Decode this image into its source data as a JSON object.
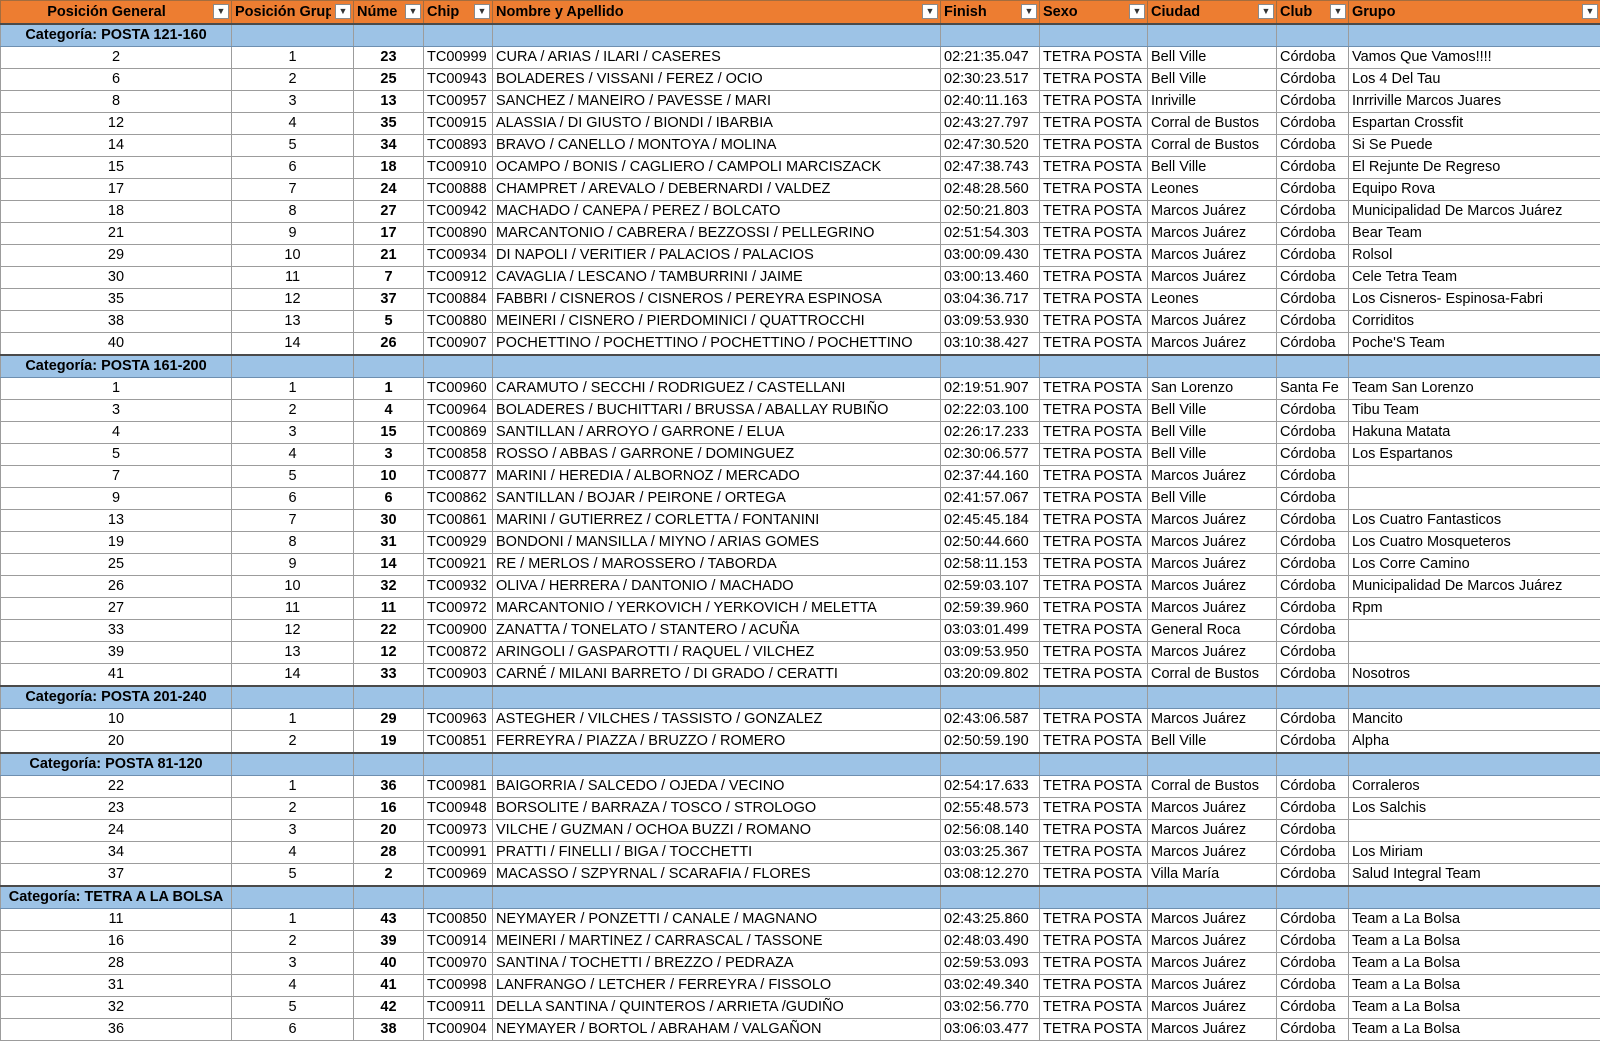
{
  "headers": {
    "pos_general": "Posición General",
    "pos_grupo": "Posición Grup",
    "numero": "Núme",
    "chip": "Chip",
    "nombre": "Nombre y Apellido",
    "finish": "Finish",
    "sexo": "Sexo",
    "ciudad": "Ciudad",
    "club": "Club",
    "grupo": "Grupo"
  },
  "icons": {
    "filter": "dropdown-filter-icon"
  },
  "colors": {
    "header": "#ED7D31",
    "category": "#9DC3E6"
  },
  "sections": [
    {
      "category": "Categoría: POSTA 121-160",
      "rows": [
        [
          "2",
          "1",
          "23",
          "TC00999",
          "CURA / ARIAS / ILARI / CASERES",
          "02:21:35.047",
          "TETRA POSTA",
          "Bell Ville",
          "Córdoba",
          "Vamos Que Vamos!!!!"
        ],
        [
          "6",
          "2",
          "25",
          "TC00943",
          "BOLADERES / VISSANI / FEREZ / OCIO",
          "02:30:23.517",
          "TETRA POSTA",
          "Bell Ville",
          "Córdoba",
          "Los 4 Del Tau"
        ],
        [
          "8",
          "3",
          "13",
          "TC00957",
          "SANCHEZ / MANEIRO / PAVESSE / MARI",
          "02:40:11.163",
          "TETRA POSTA",
          "Inriville",
          "Córdoba",
          "Inrriville Marcos Juares"
        ],
        [
          "12",
          "4",
          "35",
          "TC00915",
          "ALASSIA / DI GIUSTO / BIONDI / IBARBIA",
          "02:43:27.797",
          "TETRA POSTA",
          "Corral de Bustos",
          "Córdoba",
          "Espartan Crossfit"
        ],
        [
          "14",
          "5",
          "34",
          "TC00893",
          "BRAVO / CANELLO / MONTOYA / MOLINA",
          "02:47:30.520",
          "TETRA POSTA",
          "Corral de Bustos",
          "Córdoba",
          "Si Se Puede"
        ],
        [
          "15",
          "6",
          "18",
          "TC00910",
          "OCAMPO / BONIS / CAGLIERO / CAMPOLI MARCISZACK",
          "02:47:38.743",
          "TETRA POSTA",
          "Bell Ville",
          "Córdoba",
          "El Rejunte De Regreso"
        ],
        [
          "17",
          "7",
          "24",
          "TC00888",
          "CHAMPRET / AREVALO  / DEBERNARDI / VALDEZ",
          "02:48:28.560",
          "TETRA POSTA",
          "Leones",
          "Córdoba",
          "Equipo Rova"
        ],
        [
          "18",
          "8",
          "27",
          "TC00942",
          "MACHADO / CANEPA / PEREZ / BOLCATO",
          "02:50:21.803",
          "TETRA POSTA",
          "Marcos Juárez",
          "Córdoba",
          "Municipalidad De Marcos Juárez"
        ],
        [
          "21",
          "9",
          "17",
          "TC00890",
          "MARCANTONIO / CABRERA / BEZZOSSI / PELLEGRINO",
          "02:51:54.303",
          "TETRA POSTA",
          "Marcos Juárez",
          "Córdoba",
          "Bear Team"
        ],
        [
          "29",
          "10",
          "21",
          "TC00934",
          "DI NAPOLI / VERITIER / PALACIOS / PALACIOS",
          "03:00:09.430",
          "TETRA POSTA",
          "Marcos Juárez",
          "Córdoba",
          "Rolsol"
        ],
        [
          "30",
          "11",
          "7",
          "TC00912",
          "CAVAGLIA / LESCANO / TAMBURRINI / JAIME",
          "03:00:13.460",
          "TETRA POSTA",
          "Marcos Juárez",
          "Córdoba",
          "Cele Tetra Team"
        ],
        [
          "35",
          "12",
          "37",
          "TC00884",
          "FABBRI / CISNEROS / CISNEROS / PEREYRA ESPINOSA",
          "03:04:36.717",
          "TETRA POSTA",
          "Leones",
          "Córdoba",
          "Los Cisneros- Espinosa-Fabri"
        ],
        [
          "38",
          "13",
          "5",
          "TC00880",
          "MEINERI / CISNERO / PIERDOMINICI / QUATTROCCHI",
          "03:09:53.930",
          "TETRA POSTA",
          "Marcos Juárez",
          "Córdoba",
          "Corriditos"
        ],
        [
          "40",
          "14",
          "26",
          "TC00907",
          "POCHETTINO / POCHETTINO / POCHETTINO / POCHETTINO",
          "03:10:38.427",
          "TETRA POSTA",
          "Marcos Juárez",
          "Córdoba",
          "Poche'S Team"
        ]
      ]
    },
    {
      "category": "Categoría: POSTA 161-200",
      "rows": [
        [
          "1",
          "1",
          "1",
          "TC00960",
          "CARAMUTO / SECCHI / RODRIGUEZ / CASTELLANI",
          "02:19:51.907",
          "TETRA POSTA",
          "San Lorenzo",
          "Santa Fe",
          "Team San Lorenzo"
        ],
        [
          "3",
          "2",
          "4",
          "TC00964",
          "BOLADERES / BUCHITTARI / BRUSSA / ABALLAY RUBIÑO",
          "02:22:03.100",
          "TETRA POSTA",
          "Bell Ville",
          "Córdoba",
          "Tibu Team"
        ],
        [
          "4",
          "3",
          "15",
          "TC00869",
          "SANTILLAN  / ARROYO / GARRONE / ELUA",
          "02:26:17.233",
          "TETRA POSTA",
          "Bell Ville",
          "Córdoba",
          "Hakuna Matata"
        ],
        [
          "5",
          "4",
          "3",
          "TC00858",
          "ROSSO / ABBAS / GARRONE / DOMINGUEZ",
          "02:30:06.577",
          "TETRA POSTA",
          "Bell Ville",
          "Córdoba",
          "Los Espartanos"
        ],
        [
          "7",
          "5",
          "10",
          "TC00877",
          "MARINI / HEREDIA /  ALBORNOZ / MERCADO",
          "02:37:44.160",
          "TETRA POSTA",
          "Marcos Juárez",
          "Córdoba",
          ""
        ],
        [
          "9",
          "6",
          "6",
          "TC00862",
          "SANTILLAN / BOJAR / PEIRONE / ORTEGA",
          "02:41:57.067",
          "TETRA POSTA",
          "Bell Ville",
          "Córdoba",
          ""
        ],
        [
          "13",
          "7",
          "30",
          "TC00861",
          "MARINI / GUTIERREZ / CORLETTA / FONTANINI",
          "02:45:45.184",
          "TETRA POSTA",
          "Marcos Juárez",
          "Córdoba",
          "Los Cuatro Fantasticos"
        ],
        [
          "19",
          "8",
          "31",
          "TC00929",
          "BONDONI / MANSILLA / MIYNO / ARIAS GOMES",
          "02:50:44.660",
          "TETRA POSTA",
          "Marcos Juárez",
          "Córdoba",
          "Los Cuatro Mosqueteros"
        ],
        [
          "25",
          "9",
          "14",
          "TC00921",
          "RE / MERLOS  / MAROSSERO / TABORDA",
          "02:58:11.153",
          "TETRA POSTA",
          "Marcos Juárez",
          "Córdoba",
          "Los Corre Camino"
        ],
        [
          "26",
          "10",
          "32",
          "TC00932",
          "OLIVA / HERRERA / DANTONIO / MACHADO",
          "02:59:03.107",
          "TETRA POSTA",
          "Marcos Juárez",
          "Córdoba",
          "Municipalidad De Marcos Juárez"
        ],
        [
          "27",
          "11",
          "11",
          "TC00972",
          "MARCANTONIO / YERKOVICH / YERKOVICH / MELETTA",
          "02:59:39.960",
          "TETRA POSTA",
          "Marcos Juárez",
          "Córdoba",
          "Rpm"
        ],
        [
          "33",
          "12",
          "22",
          "TC00900",
          "ZANATTA / TONELATO / STANTERO / ACUÑA",
          "03:03:01.499",
          "TETRA POSTA",
          "General Roca",
          "Córdoba",
          ""
        ],
        [
          "39",
          "13",
          "12",
          "TC00872",
          "ARINGOLI / GASPAROTTI / RAQUEL / VILCHEZ",
          "03:09:53.950",
          "TETRA POSTA",
          "Marcos Juárez",
          "Córdoba",
          ""
        ],
        [
          "41",
          "14",
          "33",
          "TC00903",
          "CARNÉ / MILANI BARRETO / DI GRADO  / CERATTI",
          "03:20:09.802",
          "TETRA POSTA",
          "Corral de Bustos",
          "Córdoba",
          "Nosotros"
        ]
      ]
    },
    {
      "category": "Categoría: POSTA 201-240",
      "rows": [
        [
          "10",
          "1",
          "29",
          "TC00963",
          "ASTEGHER / VILCHES / TASSISTO / GONZALEZ",
          "02:43:06.587",
          "TETRA POSTA",
          "Marcos Juárez",
          "Córdoba",
          "Mancito"
        ],
        [
          "20",
          "2",
          "19",
          "TC00851",
          "FERREYRA / PIAZZA / BRUZZO / ROMERO",
          "02:50:59.190",
          "TETRA POSTA",
          "Bell Ville",
          "Córdoba",
          "Alpha"
        ]
      ]
    },
    {
      "category": "Categoría: POSTA 81-120",
      "rows": [
        [
          "22",
          "1",
          "36",
          "TC00981",
          "BAIGORRIA / SALCEDO / OJEDA / VECINO",
          "02:54:17.633",
          "TETRA POSTA",
          "Corral de Bustos",
          "Córdoba",
          "Corraleros"
        ],
        [
          "23",
          "2",
          "16",
          "TC00948",
          "BORSOLITE / BARRAZA / TOSCO / STROLOGO",
          "02:55:48.573",
          "TETRA POSTA",
          "Marcos Juárez",
          "Córdoba",
          "Los Salchis"
        ],
        [
          "24",
          "3",
          "20",
          "TC00973",
          "VILCHE / GUZMAN / OCHOA BUZZI / ROMANO",
          "02:56:08.140",
          "TETRA POSTA",
          "Marcos Juárez",
          "Córdoba",
          ""
        ],
        [
          "34",
          "4",
          "28",
          "TC00991",
          "PRATTI / FINELLI / BIGA / TOCCHETTI",
          "03:03:25.367",
          "TETRA POSTA",
          "Marcos Juárez",
          "Córdoba",
          "Los Miriam"
        ],
        [
          "37",
          "5",
          "2",
          "TC00969",
          "MACASSO / SZPYRNAL / SCARAFIA / FLORES",
          "03:08:12.270",
          "TETRA POSTA",
          "Villa María",
          "Córdoba",
          " Salud Integral Team"
        ]
      ]
    },
    {
      "category": "Categoría: TETRA A LA BOLSA",
      "rows": [
        [
          "11",
          "1",
          "43",
          "TC00850",
          "NEYMAYER / PONZETTI / CANALE / MAGNANO",
          "02:43:25.860",
          "TETRA POSTA",
          "Marcos Juárez",
          "Córdoba",
          "Team a La Bolsa"
        ],
        [
          "16",
          "2",
          "39",
          "TC00914",
          "MEINERI / MARTINEZ / CARRASCAL / TASSONE",
          "02:48:03.490",
          "TETRA POSTA",
          "Marcos Juárez",
          "Córdoba",
          "Team a La Bolsa"
        ],
        [
          "28",
          "3",
          "40",
          "TC00970",
          "SANTINA / TOCHETTI / BREZZO / PEDRAZA",
          "02:59:53.093",
          "TETRA POSTA",
          "Marcos Juárez",
          "Córdoba",
          "Team a La Bolsa"
        ],
        [
          "31",
          "4",
          "41",
          "TC00998",
          "LANFRANGO / LETCHER / FERREYRA / FISSOLO",
          "03:02:49.340",
          "TETRA POSTA",
          "Marcos Juárez",
          "Córdoba",
          "Team a La Bolsa"
        ],
        [
          "32",
          "5",
          "42",
          "TC00911",
          "DELLA SANTINA / QUINTEROS / ARRIETA /GUDIÑO",
          "03:02:56.770",
          "TETRA POSTA",
          "Marcos Juárez",
          "Córdoba",
          "Team a La Bolsa"
        ],
        [
          "36",
          "6",
          "38",
          "TC00904",
          "NEYMAYER / BORTOL / ABRAHAM / VALGAÑON",
          "03:06:03.477",
          "TETRA POSTA",
          "Marcos Juárez",
          "Córdoba",
          "Team a La Bolsa"
        ]
      ]
    }
  ]
}
